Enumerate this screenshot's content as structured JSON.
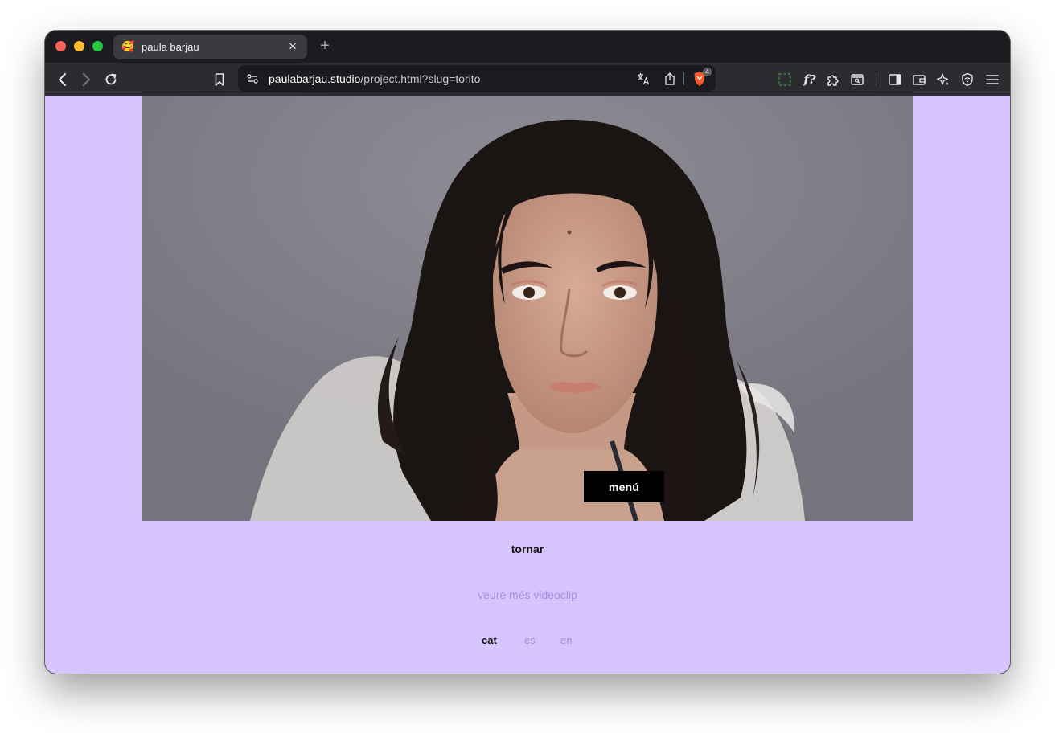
{
  "browser": {
    "tab_title": "paula barjau",
    "tab_favicon": "🥰",
    "new_tab_label": "+",
    "url_host": "paulabarjau.studio",
    "url_path": "/project.html?slug=torito",
    "brave_badge_count": "4"
  },
  "page": {
    "background_color": "#d6c6fd",
    "hero_image": "portrait of a woman with long dark wavy hair against a grey backdrop",
    "menu_label": "menú",
    "back_label": "tornar",
    "more_label": "veure més videoclip",
    "languages": [
      {
        "code": "cat",
        "active": true
      },
      {
        "code": "es",
        "active": false
      },
      {
        "code": "en",
        "active": false
      }
    ]
  }
}
